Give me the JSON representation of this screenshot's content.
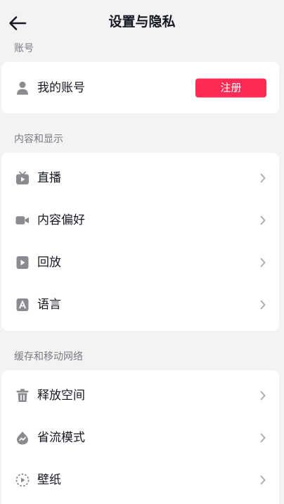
{
  "header": {
    "title": "设置与隐私",
    "back_icon": "arrow-left-icon"
  },
  "sections": {
    "account": {
      "label": "账号",
      "items": [
        {
          "label": "我的账号",
          "icon": "user-icon",
          "button_label": "注册"
        }
      ]
    },
    "content": {
      "label": "内容和显示",
      "items": [
        {
          "label": "直播",
          "icon": "tv-icon"
        },
        {
          "label": "内容偏好",
          "icon": "video-camera-icon"
        },
        {
          "label": "回放",
          "icon": "play-icon"
        },
        {
          "label": "语言",
          "icon": "language-icon"
        }
      ]
    },
    "cache": {
      "label": "缓存和移动网络",
      "items": [
        {
          "label": "释放空间",
          "icon": "trash-icon"
        },
        {
          "label": "省流模式",
          "icon": "data-saver-icon"
        },
        {
          "label": "壁纸",
          "icon": "wallpaper-icon"
        }
      ]
    }
  },
  "colors": {
    "accent": "#fe2c55",
    "background": "#f3f3f4",
    "card": "#ffffff",
    "text": "#161823",
    "secondary_text": "#7a7b80",
    "icon": "#8a8b91"
  }
}
